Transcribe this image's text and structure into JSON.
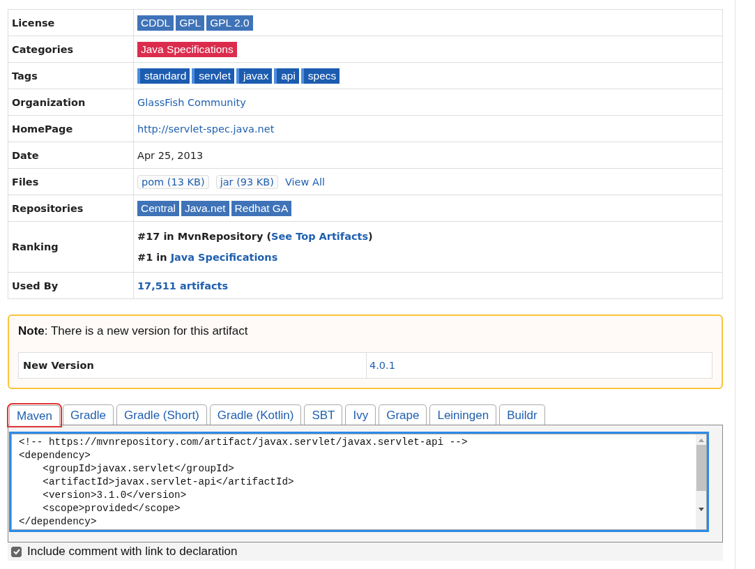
{
  "details": [
    {
      "label": "License",
      "kind": "label-badges",
      "items": [
        "CDDL",
        "GPL",
        "GPL 2.0"
      ]
    },
    {
      "label": "Categories",
      "kind": "category-badges",
      "items": [
        "Java Specifications"
      ]
    },
    {
      "label": "Tags",
      "kind": "tag-badges",
      "items": [
        "standard",
        "servlet",
        "javax",
        "api",
        "specs"
      ]
    },
    {
      "label": "Organization",
      "kind": "link",
      "value": "GlassFish Community"
    },
    {
      "label": "HomePage",
      "kind": "link",
      "value": "http://servlet-spec.java.net"
    },
    {
      "label": "Date",
      "kind": "text",
      "value": "Apr 25, 2013"
    },
    {
      "label": "Files",
      "kind": "files",
      "items": [
        "pom (13 KB)",
        "jar (93 KB)"
      ],
      "link": "View All"
    },
    {
      "label": "Repositories",
      "kind": "label-badges",
      "items": [
        "Central",
        "Java.net",
        "Redhat GA"
      ]
    },
    {
      "label": "Ranking",
      "kind": "ranking",
      "lines": [
        {
          "prefix": "#17 in MvnRepository (",
          "link": "See Top Artifacts",
          "suffix": ")"
        },
        {
          "prefix": "#1 in ",
          "link": "Java Specifications"
        }
      ]
    },
    {
      "label": "Used By",
      "kind": "bold-link",
      "value": "17,511 artifacts"
    }
  ],
  "note": {
    "text": "**Note**: There is a new version for this artifact",
    "label": "New Version",
    "value": "4.0.1"
  },
  "tabs": [
    {
      "label": "Maven",
      "selected": true,
      "highlighted": true
    },
    {
      "label": "Gradle",
      "selected": false,
      "highlighted": false
    },
    {
      "label": "Gradle (Short)",
      "selected": false,
      "highlighted": false
    },
    {
      "label": "Gradle (Kotlin)",
      "selected": false,
      "highlighted": false
    },
    {
      "label": "SBT",
      "selected": false,
      "highlighted": false
    },
    {
      "label": "Ivy",
      "selected": false,
      "highlighted": false
    },
    {
      "label": "Grape",
      "selected": false,
      "highlighted": false
    },
    {
      "label": "Leiningen",
      "selected": false,
      "highlighted": false
    },
    {
      "label": "Buildr",
      "selected": false,
      "highlighted": false
    }
  ],
  "code": {
    "highlighted": true,
    "lines": [
      "<!-- https://mvnrepository.com/artifact/javax.servlet/javax.servlet-api -->",
      "<dependency>",
      "    <groupId>javax.servlet</groupId>",
      "    <artifactId>javax.servlet-api</artifactId>",
      "    <version>3.1.0</version>",
      "    <scope>provided</scope>",
      "</dependency>"
    ]
  },
  "include_comment": {
    "label": "Include comment with link to declaration",
    "checked": true
  }
}
